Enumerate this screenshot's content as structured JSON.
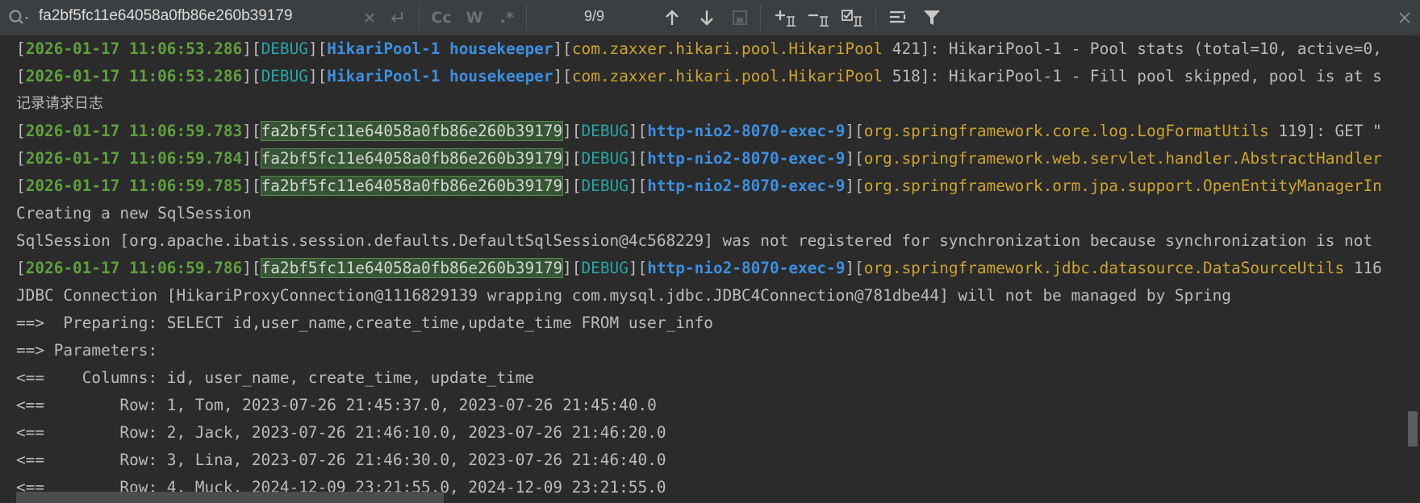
{
  "search": {
    "query": "fa2bf5fc11e64058a0fb86e260b39179",
    "match_count": "9/9"
  },
  "toolbar": {
    "match_case_label": "Cc",
    "words_label": "W",
    "regex_label": ".*",
    "icons": [
      "search-history-icon",
      "clear-icon",
      "replace-icon",
      "match-case",
      "words",
      "regex",
      "previous-occurrence-icon",
      "next-occurrence-icon",
      "filter-search-results-icon",
      "add-selection-icon",
      "remove-selection-icon",
      "select-all-occurrences-icon",
      "wrap-icon",
      "filter-icon",
      "close-icon"
    ]
  },
  "log": {
    "l1": {
      "ts": "2026-01-17 11:06:53.286",
      "level": "DEBUG",
      "thread": "HikariPool-1 housekeeper",
      "cls": "com.zaxxer.hikari.pool.HikariPool",
      "rest": " 421]: HikariPool-1 - Pool stats (total=10, active=0,"
    },
    "l2": {
      "ts": "2026-01-17 11:06:53.286",
      "level": "DEBUG",
      "thread": "HikariPool-1 housekeeper",
      "cls": "com.zaxxer.hikari.pool.HikariPool",
      "rest": " 518]: HikariPool-1 - Fill pool skipped, pool is at s"
    },
    "l3": "记录请求日志",
    "l4": {
      "ts": "2026-01-17 11:06:59.783",
      "trace": "fa2bf5fc11e64058a0fb86e260b39179",
      "level": "DEBUG",
      "thread": "http-nio2-8070-exec-9",
      "cls": "org.springframework.core.log.LogFormatUtils",
      "rest": " 119]: GET \""
    },
    "l5": {
      "ts": "2026-01-17 11:06:59.784",
      "trace": "fa2bf5fc11e64058a0fb86e260b39179",
      "level": "DEBUG",
      "thread": "http-nio2-8070-exec-9",
      "cls": "org.springframework.web.servlet.handler.AbstractHandler",
      "rest": ""
    },
    "l6": {
      "ts": "2026-01-17 11:06:59.785",
      "trace": "fa2bf5fc11e64058a0fb86e260b39179",
      "level": "DEBUG",
      "thread": "http-nio2-8070-exec-9",
      "cls": "org.springframework.orm.jpa.support.OpenEntityManagerIn",
      "rest": ""
    },
    "l7": "Creating a new SqlSession",
    "l8": "SqlSession [org.apache.ibatis.session.defaults.DefaultSqlSession@4c568229] was not registered for synchronization because synchronization is not",
    "l9": {
      "ts": "2026-01-17 11:06:59.786",
      "trace": "fa2bf5fc11e64058a0fb86e260b39179",
      "level": "DEBUG",
      "thread": "http-nio2-8070-exec-9",
      "cls": "org.springframework.jdbc.datasource.DataSourceUtils",
      "rest": " 116"
    },
    "l10": "JDBC Connection [HikariProxyConnection@1116829139 wrapping com.mysql.jdbc.JDBC4Connection@781dbe44] will not be managed by Spring",
    "l11": "==>  Preparing: SELECT id,user_name,create_time,update_time FROM user_info",
    "l12": "==> Parameters: ",
    "l13": "<==    Columns: id, user_name, create_time, update_time",
    "l14": "<==        Row: 1, Tom, 2023-07-26 21:45:37.0, 2023-07-26 21:45:40.0",
    "l15": "<==        Row: 2, Jack, 2023-07-26 21:46:10.0, 2023-07-26 21:46:20.0",
    "l16": "<==        Row: 3, Lina, 2023-07-26 21:46:30.0, 2023-07-26 21:46:40.0",
    "l17": "<==        Row: 4, Muck, 2024-12-09 23:21:55.0, 2024-12-09 23:21:55.0"
  }
}
